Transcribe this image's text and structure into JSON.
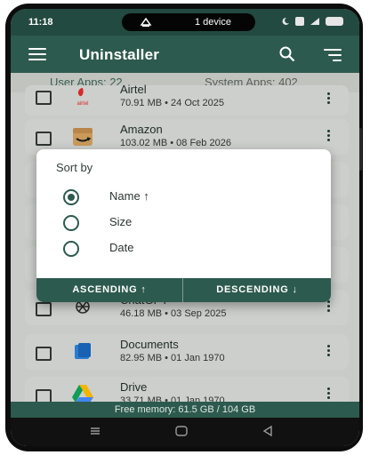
{
  "status_bar": {
    "time": "11:18",
    "center_text": "1 device"
  },
  "app_bar": {
    "title": "Uninstaller",
    "menu_icon": "hamburger-menu-icon",
    "search_icon": "search-icon",
    "sort_icon": "sort-icon"
  },
  "tabs": [
    {
      "label": "User Apps: 22",
      "selected": true
    },
    {
      "label": "System Apps: 402",
      "selected": false
    }
  ],
  "apps": [
    {
      "name": "Airtel",
      "meta": "70.91 MB • 24 Oct 2025",
      "icon": "airtel-icon"
    },
    {
      "name": "Amazon",
      "meta": "103.02 MB • 08 Feb 2026",
      "icon": "amazon-icon"
    },
    {
      "name": "ChatGPT",
      "meta": "46.18 MB • 03 Sep 2025",
      "icon": "chatgpt-icon"
    },
    {
      "name": "Documents",
      "meta": "82.95 MB • 01 Jan 1970",
      "icon": "documents-icon"
    },
    {
      "name": "Drive",
      "meta": "33.71 MB • 01 Jan 1970",
      "icon": "drive-icon"
    }
  ],
  "footer": {
    "memory_text": "Free memory: 61.5 GB / 104 GB"
  },
  "dialog": {
    "title": "Sort by",
    "options": [
      {
        "label": "Name ↑",
        "selected": true
      },
      {
        "label": "Size",
        "selected": false
      },
      {
        "label": "Date",
        "selected": false
      }
    ],
    "ascending_label": "ASCENDING ↑",
    "descending_label": "DESCENDING ↓"
  },
  "colors": {
    "primary": "#2d5a4e",
    "status_bar": "#234a40",
    "scrim_bg": "#c9cbc8",
    "dialog_bg": "#ffffff"
  }
}
